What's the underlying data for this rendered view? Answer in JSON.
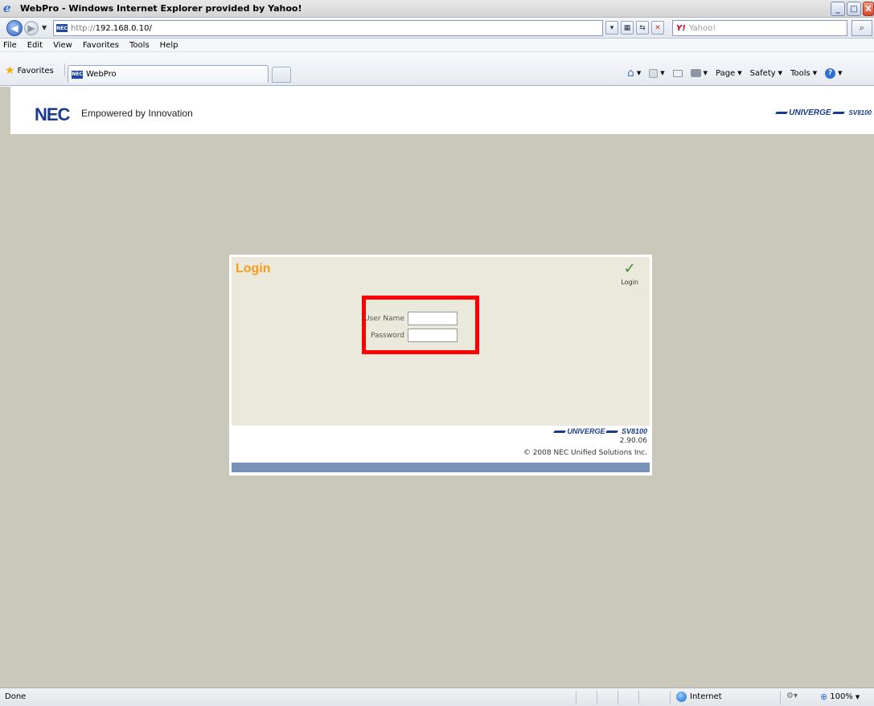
{
  "window": {
    "title": "WebPro - Windows Internet Explorer provided by Yahoo!",
    "minimize": "_",
    "maximize": "□",
    "close": "X"
  },
  "address_bar": {
    "url_scheme": "http://",
    "url_host": "192.168.0.10/",
    "favicon_text": "NEC",
    "search_placeholder": "Yahoo!",
    "search_brand": "Y!"
  },
  "menu": {
    "items": [
      "File",
      "Edit",
      "View",
      "Favorites",
      "Tools",
      "Help"
    ]
  },
  "favorites_bar": {
    "favorites_label": "Favorites",
    "tab_label": "WebPro",
    "commands": {
      "page": "Page",
      "safety": "Safety",
      "tools": "Tools"
    }
  },
  "header": {
    "logo": "NEC",
    "tagline": "Empowered by Innovation",
    "product_logo": "UNIVERGE",
    "product_model": "SV8100"
  },
  "login": {
    "title": "Login",
    "action_label": "Login",
    "username_label": "User Name",
    "username_value": "",
    "password_label": "Password",
    "password_value": "",
    "footer_product": "UNIVERGE",
    "footer_model": "SV8100",
    "version": "2.90.06",
    "copyright": "© 2008 NEC Unified Solutions Inc."
  },
  "status_bar": {
    "status": "Done",
    "zone": "Internet",
    "zoom": "100%"
  },
  "colors": {
    "page_background": "#c9c8b9",
    "login_title": "#f39c1f",
    "highlight_box": "#ff0000",
    "panel_bar": "#7891b6",
    "nec_blue": "#1a3b8c"
  }
}
